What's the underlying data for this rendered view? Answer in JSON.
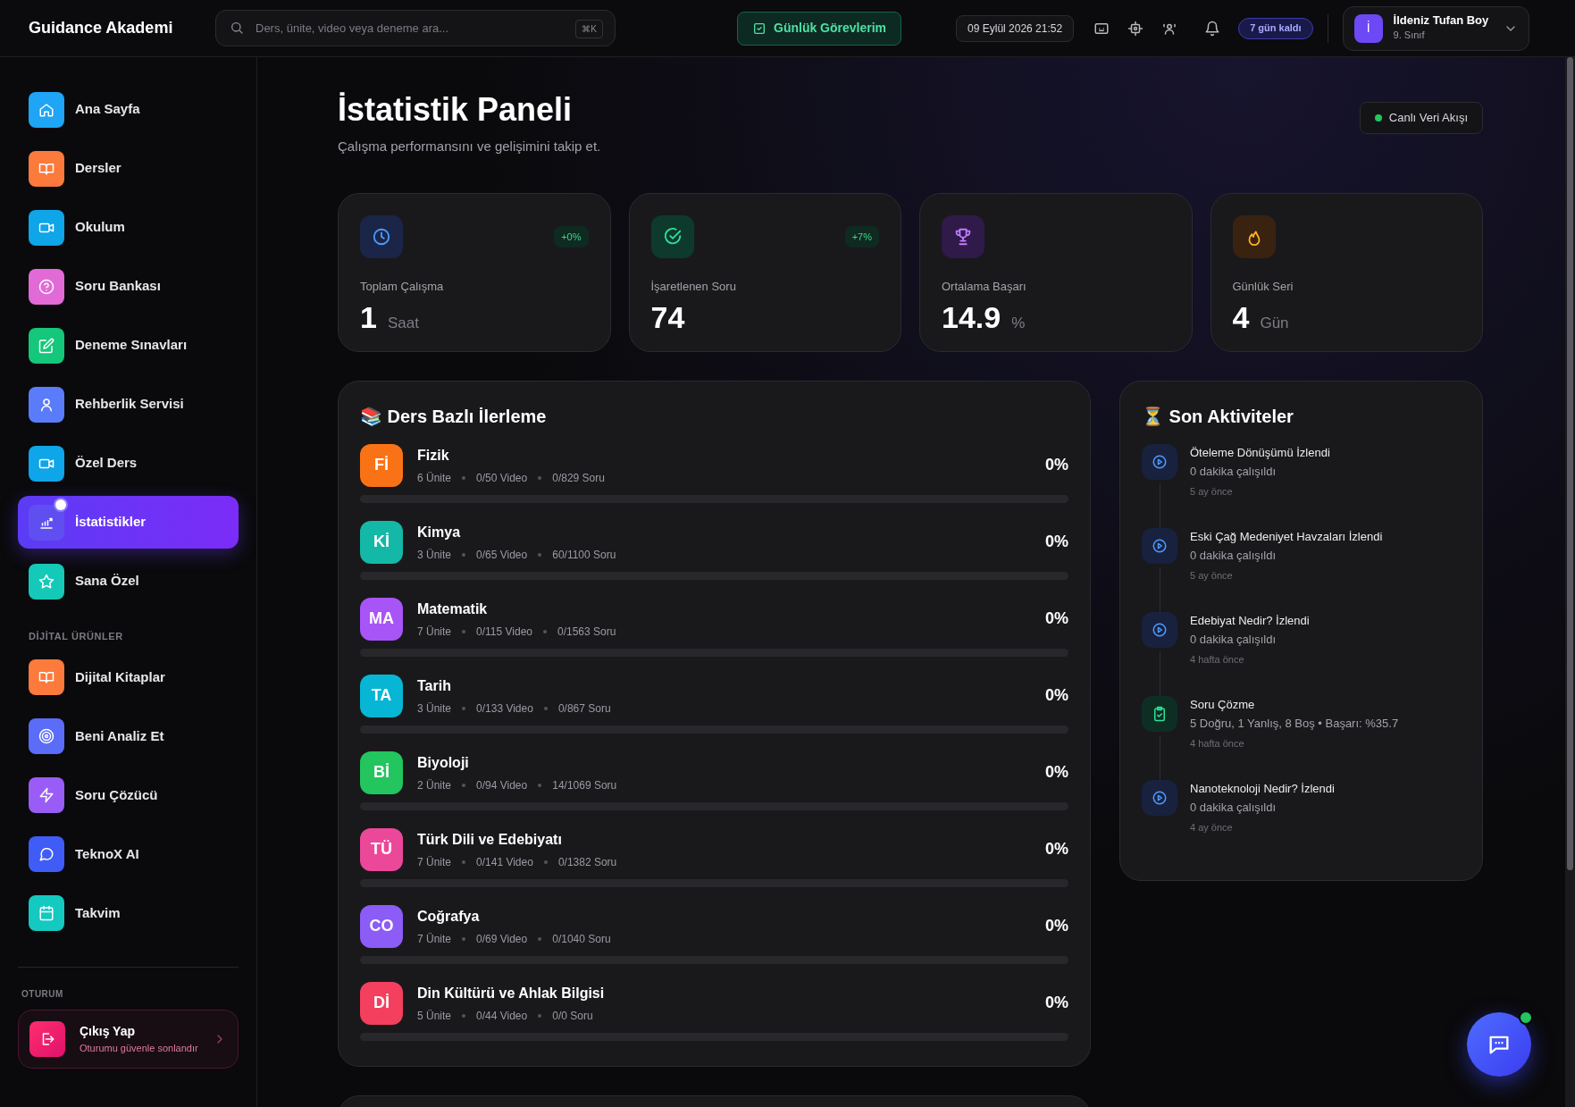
{
  "brand": "Guidance Akademi",
  "search": {
    "placeholder": "Ders, ünite, video veya deneme ara...",
    "shortcut": "⌘K"
  },
  "daily_tasks_button": "Günlük Görevlerim",
  "datetime": "09 Eylül 2026 21:52",
  "trial_badge": "7 gün kaldı",
  "user": {
    "initial": "İ",
    "name": "İldeniz Tufan Boy",
    "grade": "9. Sınıf"
  },
  "sidebar": {
    "items": [
      {
        "label": "Ana Sayfa",
        "selected": false,
        "color": "#1ea5f5"
      },
      {
        "label": "Dersler",
        "selected": false,
        "color": "#fb7a3c"
      },
      {
        "label": "Okulum",
        "selected": false,
        "color": "#0ea5e9"
      },
      {
        "label": "Soru Bankası",
        "selected": false,
        "color": "#e26ad6"
      },
      {
        "label": "Deneme Sınavları",
        "selected": false,
        "color": "#14c77a"
      },
      {
        "label": "Rehberlik Servisi",
        "selected": false,
        "color": "#5b7cfa"
      },
      {
        "label": "Özel Ders",
        "selected": false,
        "color": "#0ea5e9"
      },
      {
        "label": "İstatistikler",
        "selected": true,
        "color": "#5f4ff0"
      },
      {
        "label": "Sana Özel",
        "selected": false,
        "color": "#14c9b8"
      }
    ],
    "section_title": "DİJİTAL ÜRÜNLER",
    "products": [
      {
        "label": "Dijital Kitaplar",
        "selected": false,
        "color": "#fb7a3c"
      },
      {
        "label": "Beni Analiz Et",
        "selected": false,
        "color": "#5b6cf8"
      },
      {
        "label": "Soru Çözücü",
        "selected": false,
        "color": "#9a5cf6"
      },
      {
        "label": "TeknoX AI",
        "selected": false,
        "color": "#3f5cf6"
      },
      {
        "label": "Takvim",
        "selected": false,
        "color": "#14c9c0"
      }
    ],
    "session_title": "OTURUM",
    "logout": {
      "label": "Çıkış Yap",
      "sublabel": "Oturumu güvenle sonlandır"
    }
  },
  "page": {
    "title": "İstatistik Paneli",
    "subtitle": "Çalışma performansını ve gelişimini takip et.",
    "live_badge": "Canlı Veri Akışı"
  },
  "stats": [
    {
      "label": "Toplam Çalışma",
      "value": "1",
      "unit": "Saat",
      "trend": "+0%"
    },
    {
      "label": "İşaretlenen Soru",
      "value": "74",
      "trend": "+7%"
    },
    {
      "label": "Ortalama Başarı",
      "value": "14.9",
      "unit": "%"
    },
    {
      "label": "Günlük Seri",
      "value": "4",
      "unit": "Gün"
    }
  ],
  "progress": {
    "title": "📚 Ders Bazlı İlerleme",
    "subjects": [
      {
        "badge": "Fİ",
        "name": "Fizik",
        "units": "6 Ünite",
        "videos": "0/50 Video",
        "questions": "0/829 Soru",
        "percent": "0%",
        "color": "#f97316"
      },
      {
        "badge": "Kİ",
        "name": "Kimya",
        "units": "3 Ünite",
        "videos": "0/65 Video",
        "questions": "60/1100 Soru",
        "percent": "0%",
        "color": "#14b8a6"
      },
      {
        "badge": "MA",
        "name": "Matematik",
        "units": "7 Ünite",
        "videos": "0/115 Video",
        "questions": "0/1563 Soru",
        "percent": "0%",
        "color": "#a855f7"
      },
      {
        "badge": "TA",
        "name": "Tarih",
        "units": "3 Ünite",
        "videos": "0/133 Video",
        "questions": "0/867 Soru",
        "percent": "0%",
        "color": "#06b6d4"
      },
      {
        "badge": "Bİ",
        "name": "Biyoloji",
        "units": "2 Ünite",
        "videos": "0/94 Video",
        "questions": "14/1069 Soru",
        "percent": "0%",
        "color": "#22c55e"
      },
      {
        "badge": "TÜ",
        "name": "Türk Dili ve Edebiyatı",
        "units": "7 Ünite",
        "videos": "0/141 Video",
        "questions": "0/1382 Soru",
        "percent": "0%",
        "color": "#ec4899"
      },
      {
        "badge": "CO",
        "name": "Coğrafya",
        "units": "7 Ünite",
        "videos": "0/69 Video",
        "questions": "0/1040 Soru",
        "percent": "0%",
        "color": "#8b5cf6"
      },
      {
        "badge": "Dİ",
        "name": "Din Kültürü ve Ahlak Bilgisi",
        "units": "5 Ünite",
        "videos": "0/44 Video",
        "questions": "0/0 Soru",
        "percent": "0%",
        "color": "#f43f5e"
      }
    ]
  },
  "activities": {
    "title": "⏳ Son Aktiviteler",
    "items": [
      {
        "kind": "video",
        "title": "Öteleme Dönüşümü İzlendi",
        "detail": "0 dakika çalışıldı",
        "time": "5 ay önce"
      },
      {
        "kind": "video",
        "title": "Eski Çağ Medeniyet Havzaları İzlendi",
        "detail": "0 dakika çalışıldı",
        "time": "5 ay önce"
      },
      {
        "kind": "video",
        "title": "Edebiyat Nedir? İzlendi",
        "detail": "0 dakika çalışıldı",
        "time": "4 hafta önce"
      },
      {
        "kind": "quiz",
        "title": "Soru Çözme",
        "detail": "5 Doğru, 1 Yanlış, 8 Boş • Başarı: %35.7",
        "time": "4 hafta önce"
      },
      {
        "kind": "video",
        "title": "Nanoteknoloji Nedir? İzlendi",
        "detail": "0 dakika çalışıldı",
        "time": "4 ay önce"
      }
    ]
  }
}
